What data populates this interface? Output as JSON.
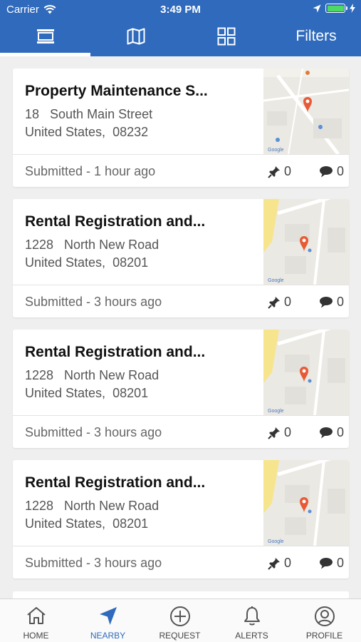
{
  "status_bar": {
    "carrier": "Carrier",
    "time": "3:49 PM"
  },
  "top_bar": {
    "tabs": [
      {
        "name": "list-view",
        "icon": "list-icon",
        "active": true
      },
      {
        "name": "map-view",
        "icon": "map-icon",
        "active": false
      },
      {
        "name": "grid-view",
        "icon": "grid-icon",
        "active": false
      }
    ],
    "filters_label": "Filters"
  },
  "requests": [
    {
      "title": "Property Maintenance S...",
      "address_line1": "18   South Main Street",
      "address_line2": "United States,  08232",
      "status": "Submitted - 1 hour ago",
      "pins": "0",
      "comments": "0"
    },
    {
      "title": "Rental Registration and...",
      "address_line1": "1228   North New Road",
      "address_line2": "United States,  08201",
      "status": "Submitted - 3 hours ago",
      "pins": "0",
      "comments": "0"
    },
    {
      "title": "Rental Registration and...",
      "address_line1": "1228   North New Road",
      "address_line2": "United States,  08201",
      "status": "Submitted - 3 hours ago",
      "pins": "0",
      "comments": "0"
    },
    {
      "title": "Rental Registration and...",
      "address_line1": "1228   North New Road",
      "address_line2": "United States,  08201",
      "status": "Submitted - 3 hours ago",
      "pins": "0",
      "comments": "0"
    }
  ],
  "bottom_nav": [
    {
      "label": "HOME",
      "icon": "home-icon"
    },
    {
      "label": "NEARBY",
      "icon": "navigation-arrow-icon",
      "active": true
    },
    {
      "label": "REQUEST",
      "icon": "plus-circle-icon"
    },
    {
      "label": "ALERTS",
      "icon": "bell-icon"
    },
    {
      "label": "PROFILE",
      "icon": "user-icon"
    }
  ],
  "colors": {
    "primary": "#2f6abc",
    "map_pin": "#e85a35",
    "background": "#efefef"
  }
}
